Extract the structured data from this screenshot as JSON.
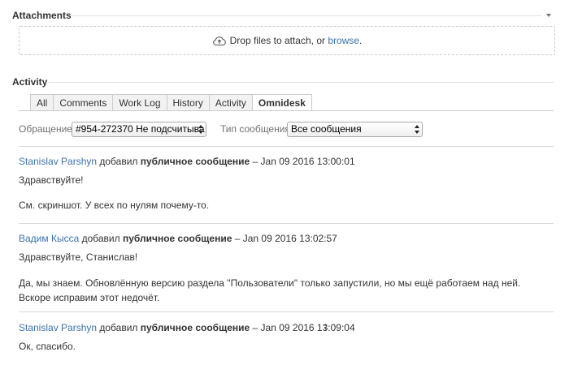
{
  "attachments": {
    "title": "Attachments",
    "drop_text": "Drop files to attach, or ",
    "browse_label": "browse",
    "drop_suffix": "."
  },
  "activity": {
    "title": "Activity",
    "tabs": [
      {
        "label": "All",
        "active": false
      },
      {
        "label": "Comments",
        "active": false
      },
      {
        "label": "Work Log",
        "active": false
      },
      {
        "label": "History",
        "active": false
      },
      {
        "label": "Activity",
        "active": false
      },
      {
        "label": "Omnidesk",
        "active": true
      }
    ]
  },
  "filters": {
    "appeal_label": "Обращение:",
    "appeal_value": "#954-272370 Не подсчитыва",
    "type_label": "Тип сообщения:",
    "type_value": "Все сообщения"
  },
  "entries": [
    {
      "author": "Stanislav Parshyn",
      "action": " добавил ",
      "kind": "публичное сообщение",
      "timestamp": " – Jan 09 2016 13:00:01",
      "paragraphs": [
        "Здравствуйте!",
        "См. скриншот. У всех по нулям почему-то."
      ]
    },
    {
      "author": "Вадим Кысса",
      "action": " добавил ",
      "kind": "публичное сообщение",
      "timestamp": " – Jan 09 2016 13:02:57",
      "paragraphs": [
        "Здравствуйте, Станислав!",
        "Да, мы знаем. Обновлённую версию раздела \"Пользователи\" только запустили, но мы ещё работаем над ней. Вскоре исправим этот недочёт."
      ]
    },
    {
      "author": "Stanislav Parshyn",
      "action": " добавил ",
      "kind": "публичное сообщение",
      "timestamp": " – Jan 09 2016 13:09:04",
      "paragraphs": [
        "Ок, спасибо."
      ]
    }
  ],
  "colors": {
    "link": "#3b73af",
    "text": "#333333",
    "muted": "#707070",
    "divider": "#d9d9d9"
  }
}
